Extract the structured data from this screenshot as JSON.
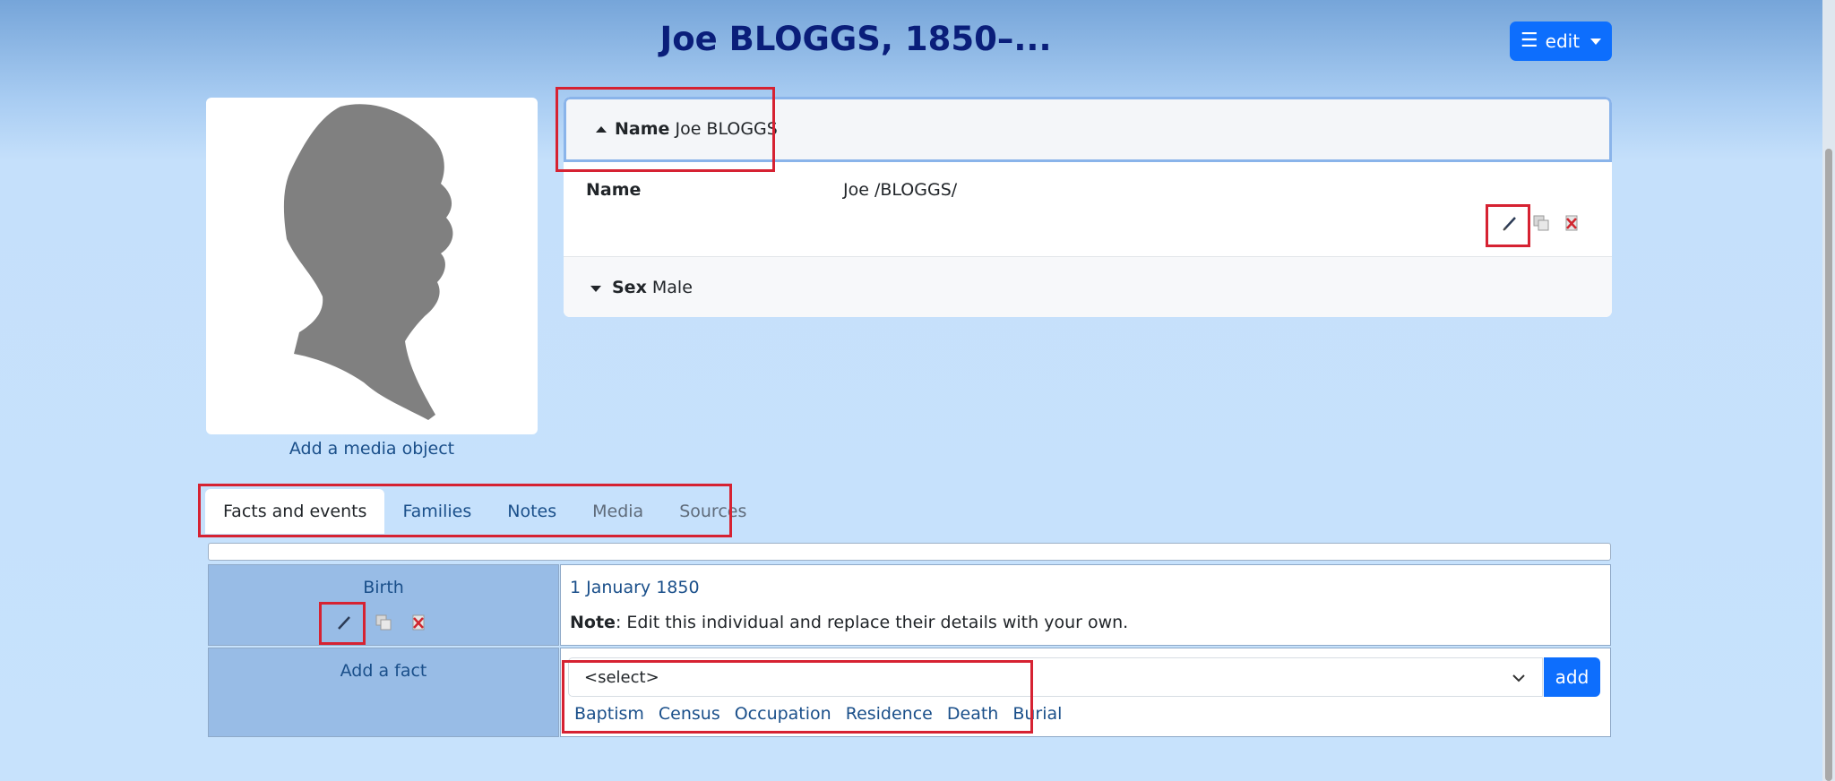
{
  "header": {
    "title": "Joe BLOGGS, 1850–...",
    "edit_label": "edit"
  },
  "media": {
    "add_label": "Add a media object"
  },
  "name_panel": {
    "header_key": "Name",
    "header_value": "Joe BLOGGS",
    "name_label": "Name",
    "name_value": "Joe /BLOGGS/",
    "sex_key": "Sex",
    "sex_value": "Male"
  },
  "tabs": [
    {
      "label": "Facts and events"
    },
    {
      "label": "Families"
    },
    {
      "label": "Notes"
    },
    {
      "label": "Media"
    },
    {
      "label": "Sources"
    }
  ],
  "facts": {
    "birth_label": "Birth",
    "birth_date": "1 January 1850",
    "note_key": "Note",
    "note_text": ": Edit this individual and replace their details with your own.",
    "add_fact_label": "Add a fact",
    "select_value": "<select>",
    "add_button": "add",
    "quick_links": [
      "Baptism",
      "Census",
      "Occupation",
      "Residence",
      "Death",
      "Burial"
    ]
  },
  "colors": {
    "primary": "#0d6efd",
    "title": "#0a1e7a",
    "link": "#1a4f8a",
    "highlight_box": "#d62232"
  }
}
